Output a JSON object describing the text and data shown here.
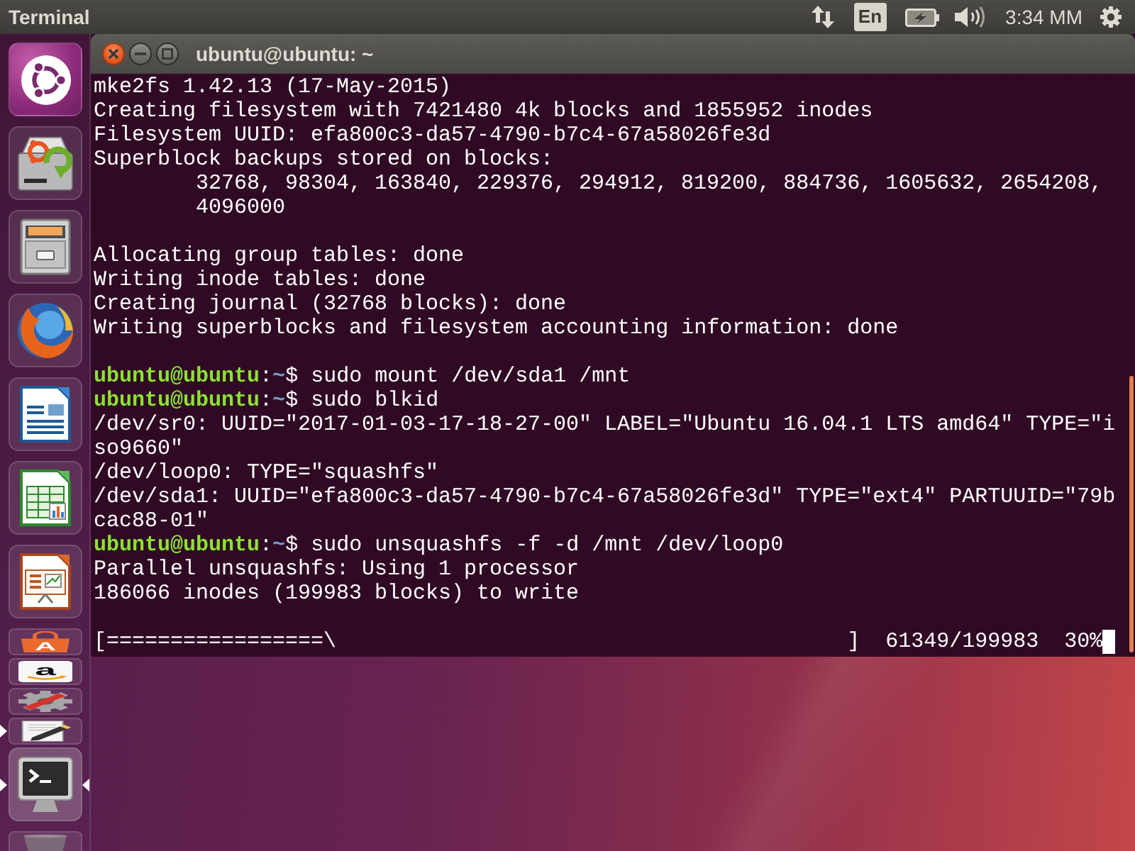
{
  "top_panel": {
    "app_title": "Terminal",
    "keyboard_layout": "En",
    "clock": "3:34 MM"
  },
  "launcher": {
    "items": [
      {
        "kind": "dash",
        "folded": false,
        "running": false,
        "focused": false
      },
      {
        "kind": "installer",
        "folded": false,
        "running": false,
        "focused": false
      },
      {
        "kind": "files",
        "folded": false,
        "running": false,
        "focused": false
      },
      {
        "kind": "browser",
        "folded": false,
        "running": false,
        "focused": false
      },
      {
        "kind": "writer",
        "folded": false,
        "running": false,
        "focused": false
      },
      {
        "kind": "calc",
        "folded": false,
        "running": false,
        "focused": false
      },
      {
        "kind": "impress",
        "folded": false,
        "running": false,
        "focused": false
      },
      {
        "kind": "store",
        "glyph": "A",
        "folded": true,
        "running": false,
        "focused": false
      },
      {
        "kind": "shop",
        "glyph": "a",
        "folded": true,
        "running": false,
        "focused": false
      },
      {
        "kind": "settings",
        "folded": true,
        "running": false,
        "focused": false
      },
      {
        "kind": "editor",
        "folded": true,
        "running": true,
        "focused": false
      },
      {
        "kind": "terminal",
        "folded": false,
        "running": true,
        "focused": true
      },
      {
        "kind": "trash",
        "folded": true,
        "running": false,
        "focused": false
      }
    ]
  },
  "terminal_window": {
    "title": "ubuntu@ubuntu: ~",
    "cursor": true,
    "lines": [
      {
        "kind": "output",
        "text": "mke2fs 1.42.13 (17-May-2015)"
      },
      {
        "kind": "output",
        "text": "Creating filesystem with 7421480 4k blocks and 1855952 inodes"
      },
      {
        "kind": "output",
        "text": "Filesystem UUID: efa800c3-da57-4790-b7c4-67a58026fe3d"
      },
      {
        "kind": "output",
        "text": "Superblock backups stored on blocks:"
      },
      {
        "kind": "indented",
        "text": "32768, 98304, 163840, 229376, 294912, 819200, 884736, 1605632, 2654208,"
      },
      {
        "kind": "indented",
        "text": "4096000"
      },
      {
        "kind": "blank"
      },
      {
        "kind": "output",
        "text": "Allocating group tables: done"
      },
      {
        "kind": "output",
        "text": "Writing inode tables: done"
      },
      {
        "kind": "output",
        "text": "Creating journal (32768 blocks): done"
      },
      {
        "kind": "output",
        "text": "Writing superblocks and filesystem accounting information: done"
      },
      {
        "kind": "blank"
      },
      {
        "kind": "prompt",
        "user_host": "ubuntu@ubuntu",
        "separator": ":",
        "cwd": "~",
        "sign": "$",
        "command": "sudo mount /dev/sda1 /mnt"
      },
      {
        "kind": "prompt",
        "user_host": "ubuntu@ubuntu",
        "separator": ":",
        "cwd": "~",
        "sign": "$",
        "command": "sudo blkid"
      },
      {
        "kind": "output",
        "text": "/dev/sr0: UUID=\"2017-01-03-17-18-27-00\" LABEL=\"Ubuntu 16.04.1 LTS amd64\" TYPE=\"i"
      },
      {
        "kind": "output",
        "text": "so9660\""
      },
      {
        "kind": "output",
        "text": "/dev/loop0: TYPE=\"squashfs\""
      },
      {
        "kind": "output",
        "text": "/dev/sda1: UUID=\"efa800c3-da57-4790-b7c4-67a58026fe3d\" TYPE=\"ext4\" PARTUUID=\"79b"
      },
      {
        "kind": "output",
        "text": "cac88-01\""
      },
      {
        "kind": "prompt",
        "user_host": "ubuntu@ubuntu",
        "separator": ":",
        "cwd": "~",
        "sign": "$",
        "command": "sudo unsquashfs -f -d /mnt /dev/loop0"
      },
      {
        "kind": "output",
        "text": "Parallel unsquashfs: Using 1 processor"
      },
      {
        "kind": "output",
        "text": "186066 inodes (199983 blocks) to write"
      },
      {
        "kind": "blank"
      },
      {
        "kind": "output",
        "text": "[=================\\                                        ]  61349/199983  30%"
      }
    ]
  }
}
